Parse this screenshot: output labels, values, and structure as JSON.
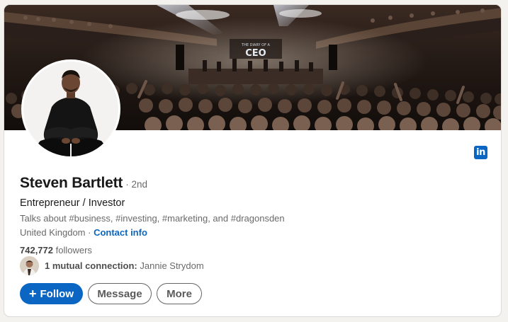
{
  "profile": {
    "name": "Steven Bartlett",
    "degree": "· 2nd",
    "headline": "Entrepreneur / Investor",
    "talks_about": "Talks about #business, #investing, #marketing, and #dragonsden",
    "location": "United Kingdom",
    "separator": " · ",
    "contact_info": "Contact info",
    "followers_count": "742,772",
    "followers_label": "followers",
    "mutual_count": "1 mutual connection:",
    "mutual_name": "Jannie Strydom"
  },
  "banner": {
    "stage_text_small": "THE DIARY OF A",
    "stage_text_large": "CEO"
  },
  "badge": {
    "icon": "linkedin-icon",
    "text": "in"
  },
  "actions": {
    "follow_icon": "+",
    "follow": "Follow",
    "message": "Message",
    "more": "More"
  },
  "colors": {
    "accent": "#0a66c2",
    "page_bg": "#f4f2ee",
    "card_bg": "#ffffff"
  }
}
